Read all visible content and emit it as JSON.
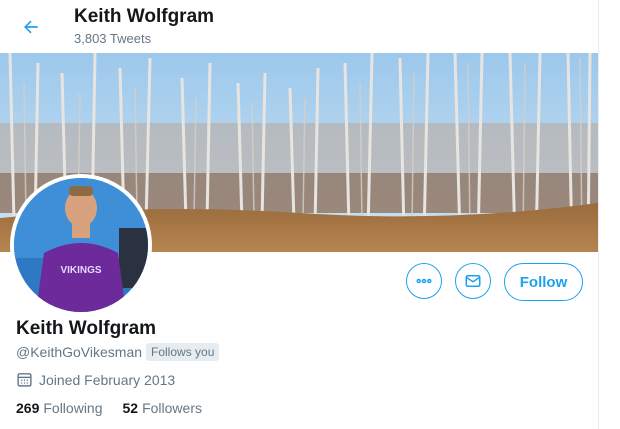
{
  "header": {
    "name": "Keith Wolfgram",
    "tweet_count": "3,803 Tweets"
  },
  "profile": {
    "name": "Keith Wolfgram",
    "handle": "@KeithGoVikesman",
    "follows_you": "Follows you",
    "joined": "Joined February 2013",
    "following_count": "269",
    "following_label": "Following",
    "followers_count": "52",
    "followers_label": "Followers"
  },
  "actions": {
    "follow_label": "Follow"
  },
  "avatar": {
    "shirt_text": "VIKINGS"
  },
  "colors": {
    "accent": "#1da1f2",
    "secondary_text": "#657786",
    "primary_text": "#14171a"
  },
  "icons": [
    "back-arrow-icon",
    "more-icon",
    "message-icon",
    "calendar-icon"
  ]
}
